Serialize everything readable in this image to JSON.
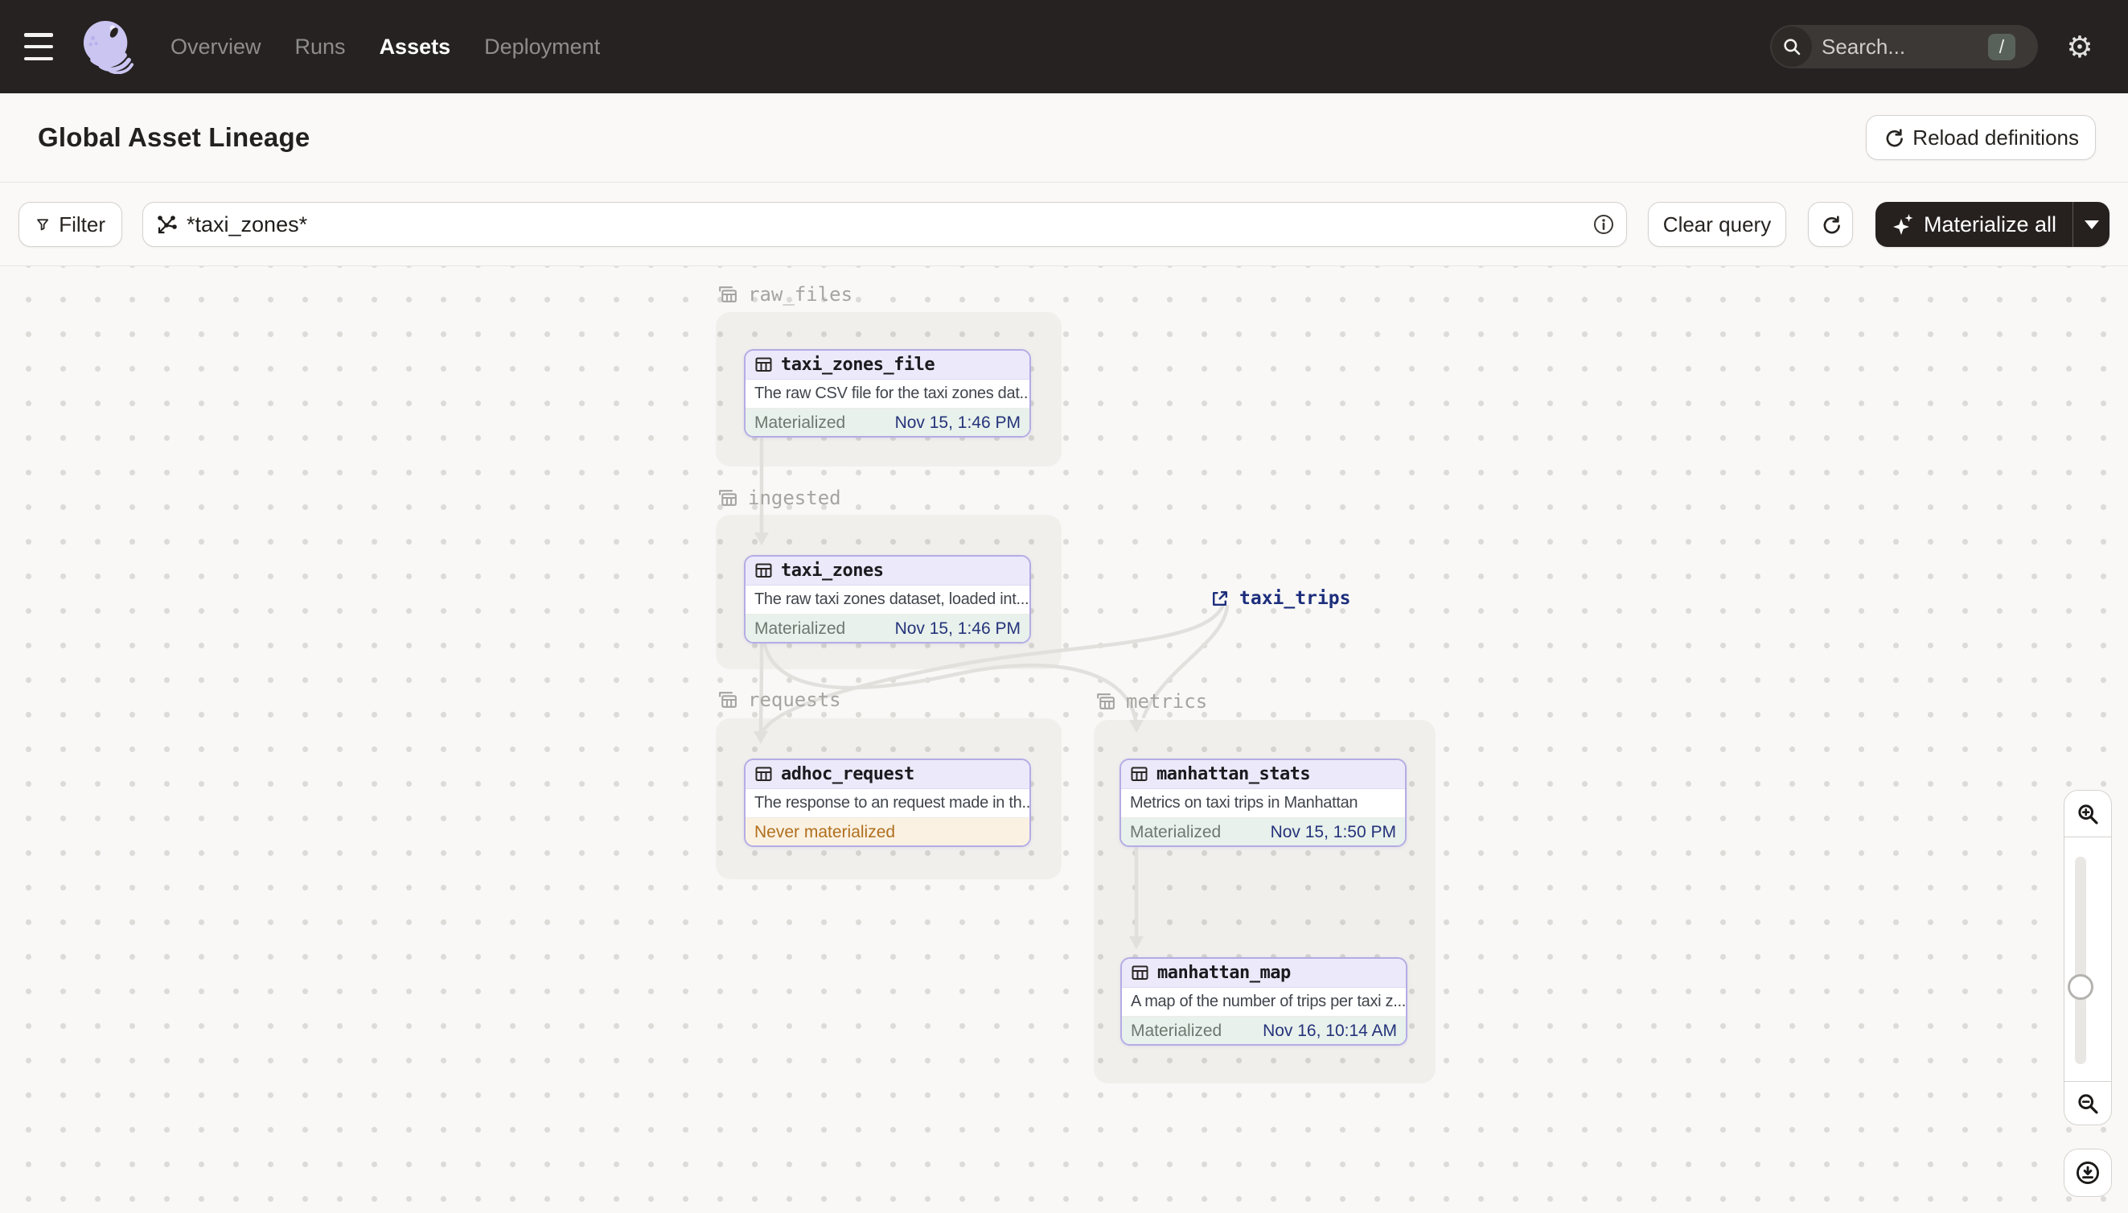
{
  "nav": {
    "items": [
      {
        "label": "Overview",
        "active": false
      },
      {
        "label": "Runs",
        "active": false
      },
      {
        "label": "Assets",
        "active": true
      },
      {
        "label": "Deployment",
        "active": false
      }
    ],
    "search_placeholder": "Search...",
    "search_shortcut": "/"
  },
  "header": {
    "title": "Global Asset Lineage",
    "reload_button": "Reload definitions"
  },
  "toolbar": {
    "filter_label": "Filter",
    "query_value": "*taxi_zones*",
    "clear_button": "Clear query",
    "materialize_button": "Materialize all"
  },
  "graph": {
    "groups": [
      {
        "name": "raw_files"
      },
      {
        "name": "ingested"
      },
      {
        "name": "requests"
      },
      {
        "name": "metrics"
      }
    ],
    "nodes": [
      {
        "name": "taxi_zones_file",
        "description": "The raw CSV file for the taxi zones dat...",
        "status": "Materialized",
        "status_time": "Nov 15, 1:46 PM",
        "status_type": "materialized"
      },
      {
        "name": "taxi_zones",
        "description": "The raw taxi zones dataset, loaded int...",
        "status": "Materialized",
        "status_time": "Nov 15, 1:46 PM",
        "status_type": "materialized"
      },
      {
        "name": "adhoc_request",
        "description": "The response to an request made in th...",
        "status": "Never materialized",
        "status_time": "",
        "status_type": "never"
      },
      {
        "name": "manhattan_stats",
        "description": "Metrics on taxi trips in Manhattan",
        "status": "Materialized",
        "status_time": "Nov 15, 1:50 PM",
        "status_type": "materialized"
      },
      {
        "name": "manhattan_map",
        "description": "A map of the number of trips per taxi z...",
        "status": "Materialized",
        "status_time": "Nov 16, 10:14 AM",
        "status_type": "materialized"
      }
    ],
    "external_asset": {
      "name": "taxi_trips"
    }
  },
  "colors": {
    "nav_bg": "#262221",
    "accent_lavender": "#B4ACE5",
    "node_header_bg": "#ECE9FA",
    "materialized_bg": "#E8F1EB",
    "materialized_time": "#25337B",
    "never_materialized_bg": "#FAF1E2",
    "never_materialized_text": "#B06F1E",
    "external_link": "#1D2E7C",
    "edge": "#E2E0DD",
    "dark_button_bg": "#26211F"
  },
  "icons": {
    "search_shortcut_badge": "/",
    "gear": "⚙",
    "caret_down": "▾"
  }
}
